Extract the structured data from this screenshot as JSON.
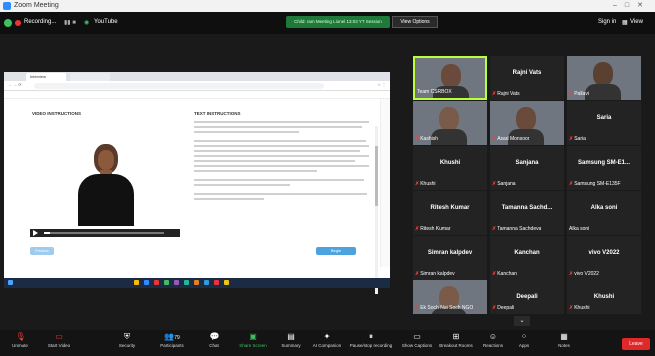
{
  "window": {
    "title": "Zoom Meeting"
  },
  "topbar": {
    "recording": "Recording...",
    "youtube": "YouTube",
    "notice": "Child: ram Meeting Lionel 13:03 YT Session",
    "view_options": "View Options",
    "signin": "Sign in",
    "view": "View"
  },
  "shared_screen": {
    "browser_tab": "Interview",
    "video_title": "VIDEO INSTRUCTIONS",
    "text_title": "TEXT INSTRUCTIONS",
    "prev_button": "Previous",
    "begin_button": "Begin",
    "video_progress": 0.05
  },
  "tiles": [
    {
      "name": "Team CSRBOX",
      "label": "Team CSRBOX",
      "muted": false,
      "video": true
    },
    {
      "name": "Rajni Vats",
      "label": "Rajni Vats",
      "muted": true,
      "video": false
    },
    {
      "name": "Pallavi",
      "label": "Pallavi",
      "muted": true,
      "video": true
    },
    {
      "name": "Kashish",
      "label": "Kashish",
      "muted": true,
      "video": true
    },
    {
      "name": "Asad Monsoor",
      "label": "Asad Monsoor",
      "muted": true,
      "video": true
    },
    {
      "name": "Saria",
      "label": "Saria",
      "muted": true,
      "video": false
    },
    {
      "name": "Khushi",
      "label": "Khushi",
      "muted": true,
      "video": false
    },
    {
      "name": "Sanjana",
      "label": "Sanjana",
      "muted": true,
      "video": false
    },
    {
      "name": "Samsung SM-E1...",
      "label": "Samsung SM-E135F",
      "muted": true,
      "video": false
    },
    {
      "name": "Ritesh Kumar",
      "label": "Ritesh Kumar",
      "muted": true,
      "video": false
    },
    {
      "name": "Tamanna Sachd...",
      "label": "Tamanna Sachdeva",
      "muted": true,
      "video": false
    },
    {
      "name": "Alka soni",
      "label": "Alka soni",
      "muted": false,
      "video": false
    },
    {
      "name": "Simran kalpdev",
      "label": "Simran kalpdev",
      "muted": true,
      "video": false
    },
    {
      "name": "Kanchan",
      "label": "Kanchan",
      "muted": true,
      "video": false
    },
    {
      "name": "vivo V2022",
      "label": "vivo V2022",
      "muted": true,
      "video": false
    },
    {
      "name": "Ek Soch Nai Soch NGO",
      "label": "Ek Soch Nai Soch NGO",
      "muted": true,
      "video": true
    },
    {
      "name": "Deepali",
      "label": "Deepali",
      "muted": true,
      "video": false
    },
    {
      "name": "Khushi",
      "label": "Khushi",
      "muted": true,
      "video": false
    }
  ],
  "toolbar": {
    "unmute": "Unmute",
    "start_video": "Start Video",
    "security": "Security",
    "participants": "Participants",
    "participants_count": "79",
    "chat": "Chat",
    "share_screen": "Share Screen",
    "summary": "Summary",
    "ai_companion": "AI Companion",
    "pause_recording": "Pause/stop recording",
    "show_captions": "Show Captions",
    "breakout_rooms": "Breakout Rooms",
    "reactions": "Reactions",
    "apps": "Apps",
    "notes": "Notes",
    "leave": "Leave"
  },
  "colors": {
    "accent_blue": "#2d8cff",
    "mute_red": "#ff3b3b",
    "active_speaker": "#b9ff3a",
    "leave_red": "#e02828"
  }
}
